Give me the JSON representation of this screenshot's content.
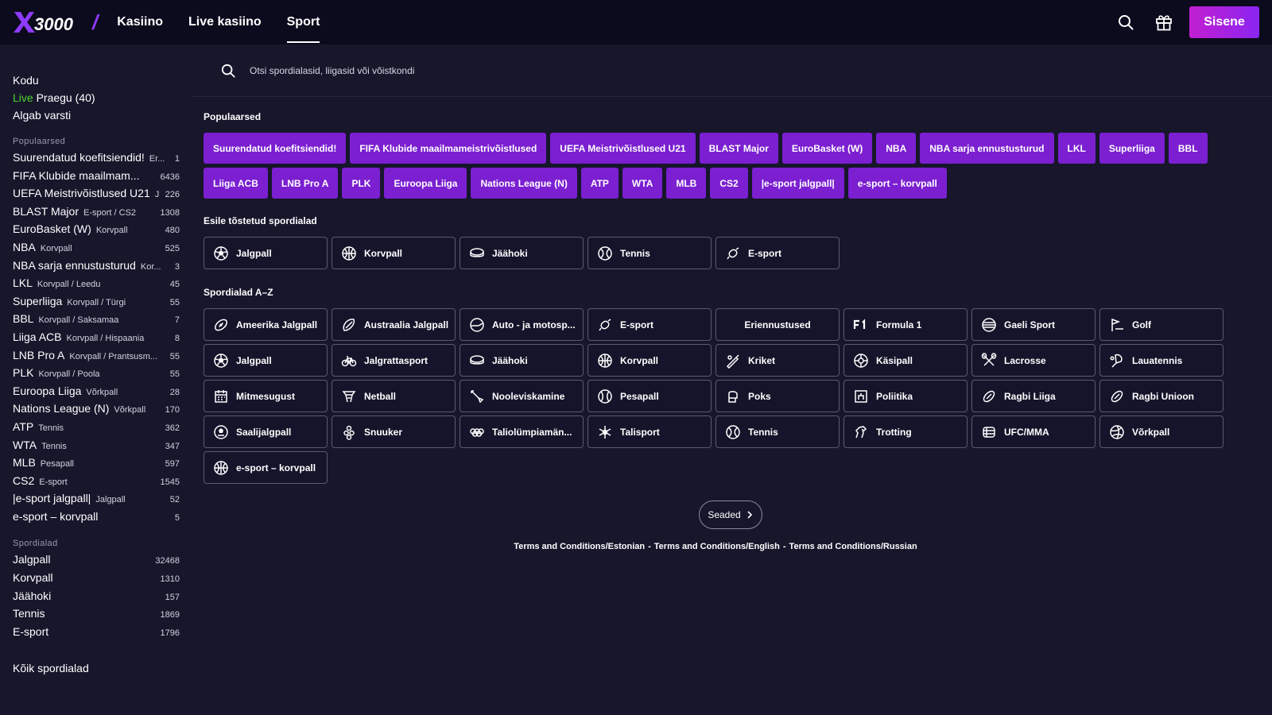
{
  "brand": {
    "logo_text": "X3000",
    "accent": "#8e3bff",
    "chip_color": "#7b1fd1",
    "live_color": "#4ed52e"
  },
  "header": {
    "nav": [
      {
        "label": "Kasiino",
        "active": false
      },
      {
        "label": "Live kasiino",
        "active": false
      },
      {
        "label": "Sport",
        "active": true
      }
    ],
    "search_icon": "search-icon",
    "gift_icon": "gift-icon",
    "login_label": "Sisene"
  },
  "sidebar": {
    "top_links": {
      "home": "Kodu",
      "live_prefix": "Live",
      "live_label": "Praegu",
      "live_count": "(40)",
      "starting": "Algab varsti"
    },
    "popular_title": "Populaarsed",
    "popular": [
      {
        "name": "Suurendatud koefitsiendid!",
        "sub": "Er...",
        "count": "1"
      },
      {
        "name": "FIFA Klubide maailmam...",
        "sub": "",
        "count": "6436"
      },
      {
        "name": "UEFA Meistrivõistlused U21",
        "sub": "J",
        "count": "226"
      },
      {
        "name": "BLAST Major",
        "sub": "E-sport / CS2",
        "count": "1308"
      },
      {
        "name": "EuroBasket (W)",
        "sub": "Korvpall",
        "count": "480"
      },
      {
        "name": "NBA",
        "sub": "Korvpall",
        "count": "525"
      },
      {
        "name": "NBA sarja ennustusturud",
        "sub": "Kor...",
        "count": "3"
      },
      {
        "name": "LKL",
        "sub": "Korvpall / Leedu",
        "count": "45"
      },
      {
        "name": "Superliiga",
        "sub": "Korvpall / Türgi",
        "count": "55"
      },
      {
        "name": "BBL",
        "sub": "Korvpall / Saksamaa",
        "count": "7"
      },
      {
        "name": "Liiga ACB",
        "sub": "Korvpall / Hispaania",
        "count": "8"
      },
      {
        "name": "LNB Pro A",
        "sub": "Korvpall / Prantsusm...",
        "count": "55"
      },
      {
        "name": "PLK",
        "sub": "Korvpall / Poola",
        "count": "55"
      },
      {
        "name": "Euroopa Liiga",
        "sub": "Võrkpall",
        "count": "28"
      },
      {
        "name": "Nations League (N)",
        "sub": "Võrkpall",
        "count": "170"
      },
      {
        "name": "ATP",
        "sub": "Tennis",
        "count": "362"
      },
      {
        "name": "WTA",
        "sub": "Tennis",
        "count": "347"
      },
      {
        "name": "MLB",
        "sub": "Pesapall",
        "count": "597"
      },
      {
        "name": "CS2",
        "sub": "E-sport",
        "count": "1545"
      },
      {
        "name": "|e-sport jalgpall|",
        "sub": "Jalgpall",
        "count": "52"
      },
      {
        "name": "e-sport – korvpall",
        "sub": "",
        "count": "5"
      }
    ],
    "sports_title": "Spordialad",
    "sports": [
      {
        "name": "Jalgpall",
        "count": "32468"
      },
      {
        "name": "Korvpall",
        "count": "1310"
      },
      {
        "name": "Jäähoki",
        "count": "157"
      },
      {
        "name": "Tennis",
        "count": "1869"
      },
      {
        "name": "E-sport",
        "count": "1796"
      }
    ],
    "all_sports": "Kõik spordialad"
  },
  "search": {
    "placeholder": "Otsi spordialasid, liigasid või võistkondi"
  },
  "popular_section": {
    "title": "Populaarsed",
    "chips": [
      "Suurendatud koefitsiendid!",
      "FIFA Klubide maailmameistrivõistlused",
      "UEFA Meistrivõistlused U21",
      "BLAST Major",
      "EuroBasket (W)",
      "NBA",
      "NBA sarja ennustusturud",
      "LKL",
      "Superliiga",
      "BBL",
      "Liiga ACB",
      "LNB Pro A",
      "PLK",
      "Euroopa Liiga",
      "Nations League (N)",
      "ATP",
      "WTA",
      "MLB",
      "CS2",
      "|e-sport jalgpall|",
      "e-sport – korvpall"
    ]
  },
  "featured_section": {
    "title": "Esile tõstetud spordialad",
    "items": [
      {
        "label": "Jalgpall",
        "icon": "soccer-ball-icon"
      },
      {
        "label": "Korvpall",
        "icon": "basketball-icon"
      },
      {
        "label": "Jäähoki",
        "icon": "hockey-puck-icon"
      },
      {
        "label": "Tennis",
        "icon": "tennis-ball-icon"
      },
      {
        "label": "E-sport",
        "icon": "gamepad-icon"
      }
    ]
  },
  "az_section": {
    "title": "Spordialad A–Z",
    "items": [
      {
        "label": "Ameerika Jalgpall",
        "icon": "american-football-icon"
      },
      {
        "label": "Austraalia Jalgpall",
        "icon": "aussie-rules-icon"
      },
      {
        "label": "Auto - ja motosp...",
        "icon": "motorsport-icon"
      },
      {
        "label": "E-sport",
        "icon": "gamepad-icon"
      },
      {
        "label": "Eriennustused",
        "icon": ""
      },
      {
        "label": "Formula 1",
        "icon": "f1-icon"
      },
      {
        "label": "Gaeli Sport",
        "icon": "gaelic-ball-icon"
      },
      {
        "label": "Golf",
        "icon": "golf-icon"
      },
      {
        "label": "Jalgpall",
        "icon": "soccer-ball-icon"
      },
      {
        "label": "Jalgrattasport",
        "icon": "bicycle-icon"
      },
      {
        "label": "Jäähoki",
        "icon": "hockey-puck-icon"
      },
      {
        "label": "Korvpall",
        "icon": "basketball-icon"
      },
      {
        "label": "Kriket",
        "icon": "cricket-icon"
      },
      {
        "label": "Käsipall",
        "icon": "handball-icon"
      },
      {
        "label": "Lacrosse",
        "icon": "lacrosse-icon"
      },
      {
        "label": "Lauatennis",
        "icon": "table-tennis-icon"
      },
      {
        "label": "Mitmesugust",
        "icon": "calendar-icon"
      },
      {
        "label": "Netball",
        "icon": "netball-icon"
      },
      {
        "label": "Nooleviskamine",
        "icon": "dart-icon"
      },
      {
        "label": "Pesapall",
        "icon": "baseball-icon"
      },
      {
        "label": "Poks",
        "icon": "boxing-glove-icon"
      },
      {
        "label": "Poliitika",
        "icon": "politics-icon"
      },
      {
        "label": "Ragbi Liiga",
        "icon": "rugby-ball-icon"
      },
      {
        "label": "Ragbi Unioon",
        "icon": "rugby-ball-icon"
      },
      {
        "label": "Saalijalgpall",
        "icon": "futsal-icon"
      },
      {
        "label": "Snuuker",
        "icon": "snooker-icon"
      },
      {
        "label": "Taliolümpiamän...",
        "icon": "olympic-rings-icon"
      },
      {
        "label": "Talisport",
        "icon": "snowflake-icon"
      },
      {
        "label": "Tennis",
        "icon": "tennis-ball-icon"
      },
      {
        "label": "Trotting",
        "icon": "horse-icon"
      },
      {
        "label": "UFC/MMA",
        "icon": "mma-icon"
      },
      {
        "label": "Võrkpall",
        "icon": "volleyball-icon"
      },
      {
        "label": "e-sport – korvpall",
        "icon": "basketball-icon"
      }
    ]
  },
  "settings_label": "Seaded",
  "footer_links": [
    "Terms and Conditions/Estonian",
    "Terms and Conditions/English",
    "Terms and Conditions/Russian"
  ],
  "footer_separator": "-"
}
